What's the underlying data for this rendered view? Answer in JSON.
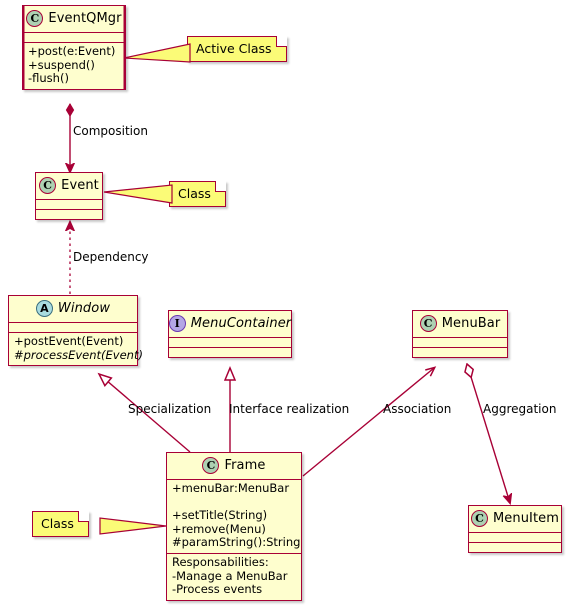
{
  "diagram": {
    "kind": "uml-class-diagram",
    "colors": {
      "class_fill": "#FEFECE",
      "class_border": "#A80036",
      "note_fill": "#FBFB77",
      "line": "#A80036",
      "icon_class": "#ADD1B2",
      "icon_abstract": "#A9DCDF",
      "icon_interface": "#B4A7E5",
      "background": "#FFFFFF"
    }
  },
  "classes": {
    "eventqmgr": {
      "name": "EventQMgr",
      "stereotype_letter": "C",
      "stereotype": "class",
      "active": true,
      "compartments": [
        {
          "empty": true,
          "lines": []
        },
        {
          "empty": false,
          "lines": [
            "+post(e:Event)",
            "+suspend()",
            "-flush()"
          ]
        }
      ]
    },
    "event": {
      "name": "Event",
      "stereotype_letter": "C",
      "stereotype": "class",
      "active": false,
      "compartments": [
        {
          "empty": true,
          "lines": []
        },
        {
          "empty": true,
          "lines": []
        }
      ]
    },
    "window": {
      "name": "Window",
      "stereotype_letter": "A",
      "stereotype": "abstract",
      "active": false,
      "compartments": [
        {
          "empty": true,
          "lines": []
        },
        {
          "empty": false,
          "lines": [
            "+postEvent(Event)",
            "#processEvent(Event)"
          ]
        }
      ]
    },
    "menucontainer": {
      "name": "MenuContainer",
      "stereotype_letter": "I",
      "stereotype": "interface",
      "active": false,
      "compartments": [
        {
          "empty": true,
          "lines": []
        },
        {
          "empty": true,
          "lines": []
        }
      ]
    },
    "menubar": {
      "name": "MenuBar",
      "stereotype_letter": "C",
      "stereotype": "class",
      "active": false,
      "compartments": [
        {
          "empty": true,
          "lines": []
        },
        {
          "empty": true,
          "lines": []
        }
      ]
    },
    "menuitem": {
      "name": "MenuItem",
      "stereotype_letter": "C",
      "stereotype": "class",
      "active": false,
      "compartments": [
        {
          "empty": true,
          "lines": []
        },
        {
          "empty": true,
          "lines": []
        }
      ]
    },
    "frame": {
      "name": "Frame",
      "stereotype_letter": "C",
      "stereotype": "class",
      "active": false,
      "attributes": "+menuBar:MenuBar",
      "methods": [
        "+setTitle(String)",
        "+remove(Menu)",
        "#paramString():String"
      ],
      "responsabilities": [
        "Responsabilities:",
        "-Manage a MenuBar",
        "-Process events"
      ]
    }
  },
  "notes": {
    "active_class": "Active Class",
    "event_class": "Class",
    "frame_class": "Class"
  },
  "relationships": {
    "composition": "Composition",
    "dependency": "Dependency",
    "specialization": "Specialization",
    "interface_realization": "Interface realization",
    "association": "Association",
    "aggregation": "Aggregation"
  }
}
